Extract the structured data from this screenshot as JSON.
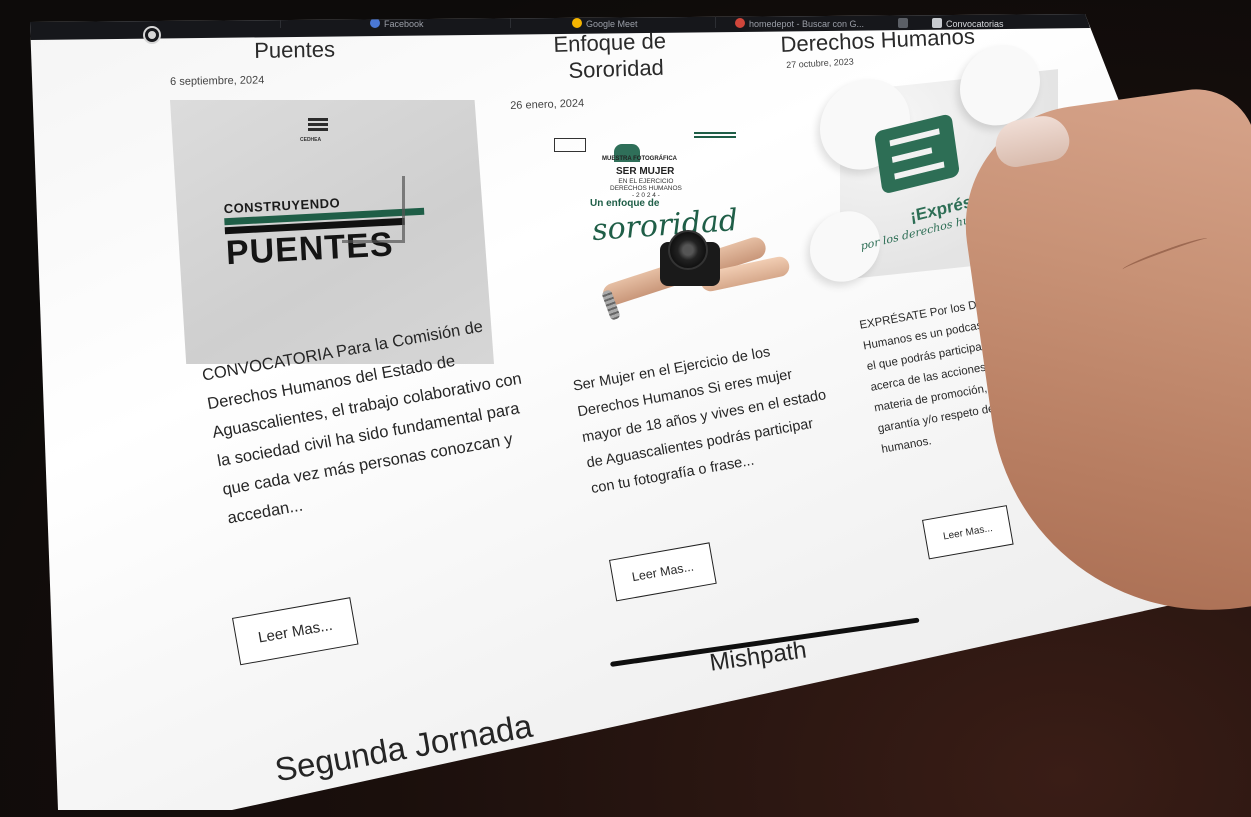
{
  "browser_tabs": [
    {
      "label": "Facebook",
      "icon": "facebook-icon",
      "color": "#4a78d6"
    },
    {
      "label": "Google Meet",
      "icon": "google-meet-icon",
      "color": "#f4b400"
    },
    {
      "label": "homedepot - Buscar con G...",
      "icon": "google-icon",
      "color": "#d0463b"
    },
    {
      "label": "",
      "icon": "tab-icon",
      "color": "#9b9fa8"
    },
    {
      "label": "Convocatorias",
      "icon": "page-icon",
      "color": "#9b9fa8"
    }
  ],
  "cards": [
    {
      "title": "Puentes",
      "date": "6 septiembre, 2024",
      "image": {
        "brand": "CEDHEA",
        "line1": "CONSTRUYENDO",
        "line2": "PUENTES"
      },
      "excerpt": "CONVOCATORIA Para la Comisión de Derechos Humanos del Estado de Aguascalientes, el trabajo colaborativo con la sociedad civil ha sido fundamental para que cada vez más personas conozcan y accedan...",
      "button": "Leer Mas..."
    },
    {
      "title_line1": "Enfoque de",
      "title_line2": "Sororidad",
      "date": "26 enero, 2024",
      "image": {
        "kicker": "MUESTRA FOTOGRÁFICA",
        "main": "SER MUJER",
        "sub1": "EN EL EJERCICIO",
        "sub2": "DERECHOS HUMANOS",
        "year": "- 2 0 2 4 -",
        "tagline1": "Un enfoque de",
        "tagline2": "sororidad"
      },
      "excerpt": "Ser Mujer en el Ejercicio de los Derechos Humanos Si eres mujer mayor de 18 años y vives en el estado de Aguascalientes podrás participar con tu fotografía o frase...",
      "button": "Leer Mas..."
    },
    {
      "title": "Derechos Humanos",
      "date": "27 octubre, 2023",
      "image": {
        "line1": "¡Exprésate!",
        "line2": "por los derechos humanos"
      },
      "excerpt": "EXPRÉSATE Por los Derechos Humanos es un podcast y video blog en el que podrás participar para platicar acerca de las acciones que realizas en materia de promoción, protección, garantía y/o respeto de los derechos humanos.",
      "button": "Leer Mas..."
    }
  ],
  "next_titles": {
    "left": "Segunda Jornada",
    "middle": "Mishpath"
  },
  "scroll_top_icon": "chevron-up-icon",
  "accent_color": "#1f5e47"
}
